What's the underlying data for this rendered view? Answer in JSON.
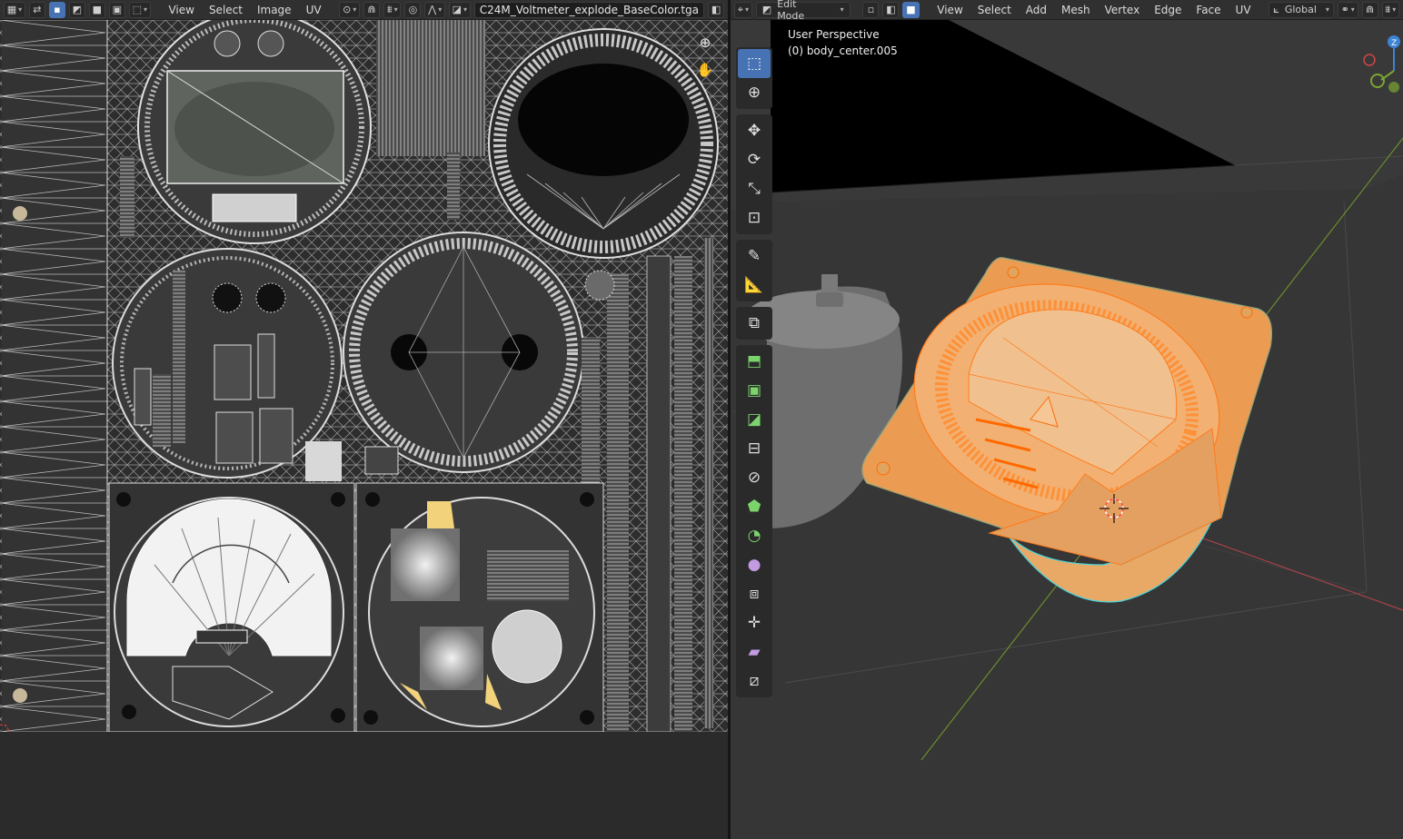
{
  "uv_editor": {
    "header": {
      "menus": [
        "View",
        "Select",
        "Image",
        "UV"
      ],
      "image_name": "C24M_Voltmeter_explode_BaseColor.tga"
    }
  },
  "viewport": {
    "header": {
      "mode": "Edit Mode",
      "menus": [
        "View",
        "Select",
        "Add",
        "Mesh",
        "Vertex",
        "Edge",
        "Face",
        "UV"
      ],
      "orientation": "Global"
    },
    "info": {
      "perspective": "User Perspective",
      "object": "(0) body_center.005"
    },
    "gizmo_axes": [
      "X",
      "Y",
      "Z"
    ]
  },
  "colors": {
    "accent": "#4772b3",
    "selection": "#ff8a1a",
    "mesh_fill": "#e8a866",
    "x_axis": "#d04545",
    "y_axis": "#7aa532",
    "z_axis": "#3d83d6"
  },
  "icons": {
    "toolbar": [
      "select-box-icon",
      "cursor-icon",
      "move-icon",
      "rotate-icon",
      "scale-icon",
      "transform-icon",
      "annotate-icon",
      "measure-icon",
      "add-cube-icon",
      "extrude-icon",
      "inset-icon",
      "bevel-icon",
      "loop-cut-icon",
      "knife-icon",
      "poly-build-icon",
      "spin-icon",
      "smooth-icon",
      "edge-slide-icon",
      "shrink-fatten-icon",
      "shear-icon",
      "rip-icon"
    ]
  }
}
